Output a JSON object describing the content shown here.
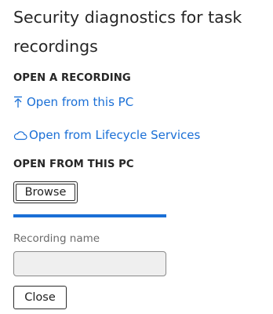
{
  "panel": {
    "title": "Security diagnostics for task recordings"
  },
  "open_recording": {
    "section_label": "OPEN A RECORDING",
    "links": [
      {
        "label": "Open from this PC",
        "icon": "upload-arrow-icon"
      },
      {
        "label": "Open from Lifecycle Services",
        "icon": "cloud-icon"
      }
    ]
  },
  "open_from_pc": {
    "section_label": "OPEN FROM THIS PC",
    "browse_label": "Browse",
    "progress": 1.0
  },
  "recording_name": {
    "label": "Recording name",
    "value": "",
    "placeholder": ""
  },
  "footer": {
    "close_label": "Close"
  },
  "colors": {
    "link": "#1a6fd6",
    "progress": "#1a6fd6",
    "input_background": "#efefef"
  }
}
